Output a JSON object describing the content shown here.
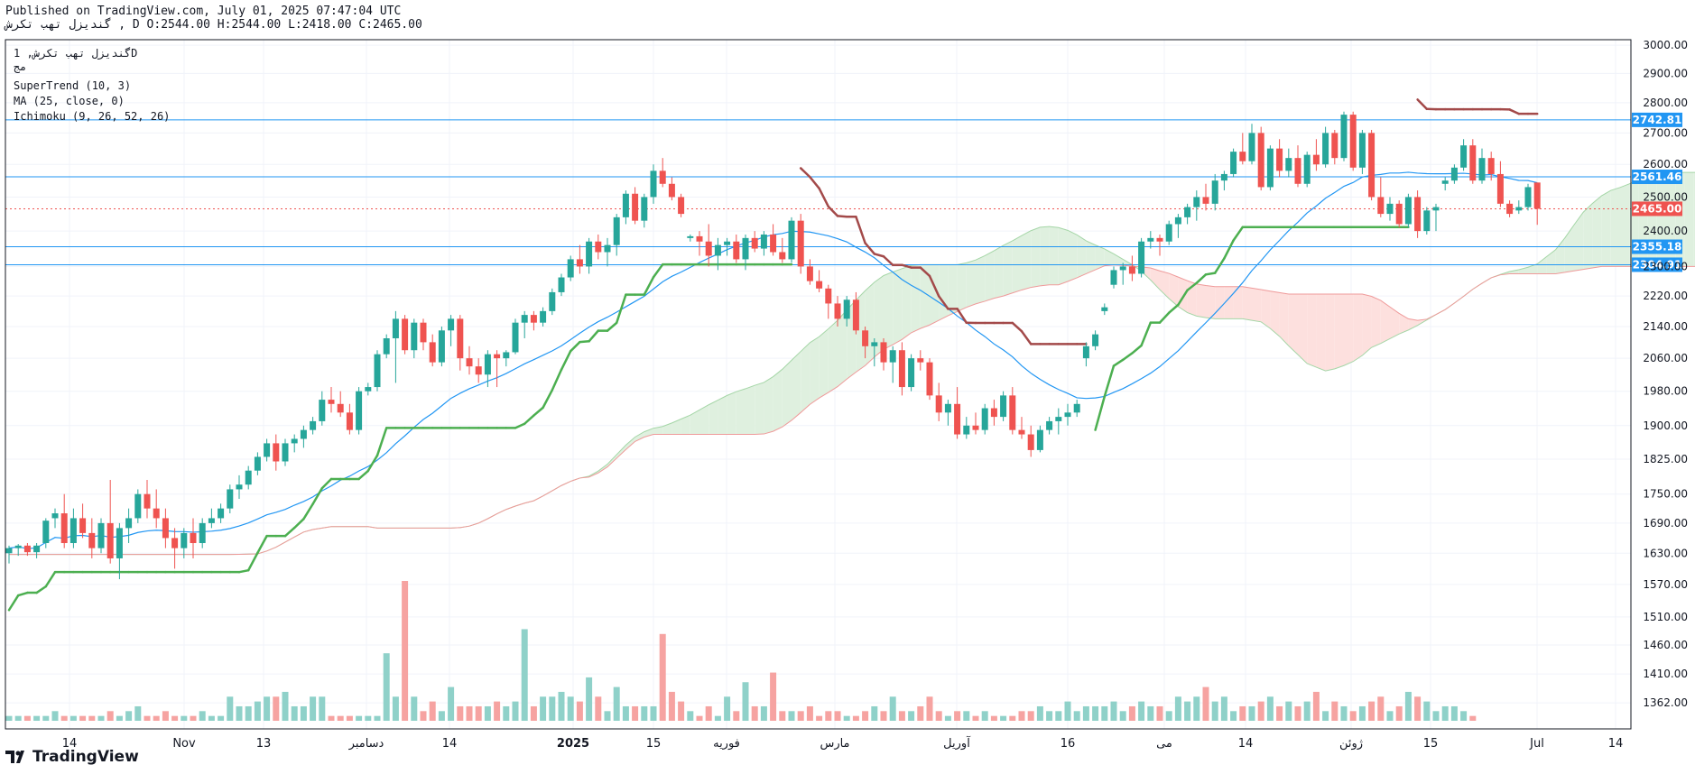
{
  "header": {
    "published_line": "Published on TradingView.com, July 01, 2025 07:47:04 UTC",
    "symbol_line": "گندیزل تهب تکرش , D O:2544.00 H:2544.00 L:2418.00 C:2465.00"
  },
  "legend": {
    "symbol": "گندیزل تهب تکرش, 1D",
    "subtitle": "مج",
    "indicator_1": "SuperTrend (10, 3)",
    "indicator_2": "MA (25, close, 0)",
    "indicator_3": "Ichimoku (9, 26, 52, 26)"
  },
  "footer": {
    "brand": "TradingView"
  },
  "colors": {
    "up": "#26a69a",
    "down": "#ef5350",
    "up_volume": "#8fd1c9",
    "down_volume": "#f6a3a1",
    "supertrend_up": "#4caf50",
    "supertrend_down": "#a34a4a",
    "ma": "#2196f3",
    "hline": "#2196f3",
    "cloud_bull": "#dff0df",
    "cloud_bear": "#fde0de",
    "last_price": "#ef5350"
  },
  "chart_data": {
    "type": "candlestick",
    "timeframe": "1D",
    "ohlc_last": {
      "open": 2544.0,
      "high": 2544.0,
      "low": 2418.0,
      "close": 2465.0
    },
    "y_scale": "log",
    "ylim": [
      1320,
      3020
    ],
    "y_ticks": [
      "3000.00",
      "2900.00",
      "2800.00",
      "2700.00",
      "2600.00",
      "2500.00",
      "2400.00",
      "2300.00",
      "2220.00",
      "2140.00",
      "2060.00",
      "1980.00",
      "1900.00",
      "1825.00",
      "1750.00",
      "1690.00",
      "1630.00",
      "1570.00",
      "1510.00",
      "1460.00",
      "1410.00",
      "1362.00"
    ],
    "x_ticks": [
      "14",
      "Nov",
      "13",
      "دسامبر",
      "14",
      "2025",
      "15",
      "فوریه",
      "مارس",
      "آوریل",
      "16",
      "می",
      "14",
      "ژوئن",
      "15",
      "Jul",
      "14"
    ],
    "horizontal_levels": [
      {
        "price": 2742.81,
        "label": "2742.81"
      },
      {
        "price": 2561.46,
        "label": "2561.46"
      },
      {
        "price": 2355.18,
        "label": "2355.18"
      },
      {
        "price": 2304.91,
        "label": "2304.91"
      }
    ],
    "last_price": {
      "price": 2465.0,
      "label": "2465.00"
    },
    "candles": [
      [
        1630,
        1645,
        1610,
        1640
      ],
      [
        1640,
        1648,
        1625,
        1645
      ],
      [
        1645,
        1650,
        1625,
        1632
      ],
      [
        1632,
        1650,
        1620,
        1645
      ],
      [
        1650,
        1700,
        1640,
        1695
      ],
      [
        1700,
        1720,
        1680,
        1710
      ],
      [
        1710,
        1750,
        1640,
        1650
      ],
      [
        1650,
        1720,
        1640,
        1700
      ],
      [
        1700,
        1730,
        1660,
        1670
      ],
      [
        1670,
        1700,
        1620,
        1640
      ],
      [
        1640,
        1700,
        1630,
        1690
      ],
      [
        1690,
        1780,
        1610,
        1620
      ],
      [
        1620,
        1690,
        1580,
        1680
      ],
      [
        1680,
        1720,
        1650,
        1700
      ],
      [
        1700,
        1760,
        1690,
        1750
      ],
      [
        1750,
        1780,
        1700,
        1720
      ],
      [
        1720,
        1760,
        1680,
        1700
      ],
      [
        1700,
        1720,
        1640,
        1660
      ],
      [
        1660,
        1680,
        1600,
        1640
      ],
      [
        1640,
        1680,
        1620,
        1670
      ],
      [
        1670,
        1700,
        1620,
        1650
      ],
      [
        1650,
        1700,
        1640,
        1690
      ],
      [
        1690,
        1720,
        1680,
        1700
      ],
      [
        1700,
        1730,
        1690,
        1720
      ],
      [
        1720,
        1770,
        1710,
        1760
      ],
      [
        1760,
        1790,
        1740,
        1770
      ],
      [
        1770,
        1810,
        1760,
        1800
      ],
      [
        1800,
        1840,
        1790,
        1830
      ],
      [
        1830,
        1870,
        1820,
        1860
      ],
      [
        1860,
        1880,
        1800,
        1820
      ],
      [
        1820,
        1870,
        1810,
        1860
      ],
      [
        1860,
        1880,
        1840,
        1870
      ],
      [
        1870,
        1900,
        1850,
        1890
      ],
      [
        1890,
        1920,
        1880,
        1910
      ],
      [
        1910,
        1980,
        1900,
        1960
      ],
      [
        1960,
        1990,
        1930,
        1950
      ],
      [
        1950,
        1980,
        1920,
        1930
      ],
      [
        1930,
        1950,
        1880,
        1890
      ],
      [
        1890,
        1990,
        1880,
        1980
      ],
      [
        1980,
        2000,
        1970,
        1990
      ],
      [
        1990,
        2080,
        1980,
        2070
      ],
      [
        2070,
        2120,
        2060,
        2110
      ],
      [
        2110,
        2180,
        2000,
        2160
      ],
      [
        2160,
        2170,
        2070,
        2080
      ],
      [
        2080,
        2160,
        2060,
        2150
      ],
      [
        2150,
        2160,
        2080,
        2100
      ],
      [
        2100,
        2120,
        2040,
        2050
      ],
      [
        2050,
        2140,
        2040,
        2130
      ],
      [
        2130,
        2170,
        2090,
        2160
      ],
      [
        2160,
        2170,
        2030,
        2060
      ],
      [
        2060,
        2090,
        2020,
        2040
      ],
      [
        2040,
        2060,
        2000,
        2020
      ],
      [
        2020,
        2080,
        1990,
        2070
      ],
      [
        2070,
        2080,
        1990,
        2060
      ],
      [
        2060,
        2080,
        2040,
        2075
      ],
      [
        2075,
        2160,
        2070,
        2150
      ],
      [
        2150,
        2180,
        2110,
        2170
      ],
      [
        2170,
        2180,
        2130,
        2150
      ],
      [
        2150,
        2190,
        2140,
        2180
      ],
      [
        2180,
        2240,
        2170,
        2230
      ],
      [
        2230,
        2280,
        2220,
        2270
      ],
      [
        2270,
        2330,
        2260,
        2320
      ],
      [
        2320,
        2360,
        2280,
        2300
      ],
      [
        2300,
        2380,
        2280,
        2370
      ],
      [
        2370,
        2390,
        2320,
        2340
      ],
      [
        2340,
        2380,
        2300,
        2360
      ],
      [
        2360,
        2450,
        2330,
        2440
      ],
      [
        2440,
        2520,
        2420,
        2510
      ],
      [
        2510,
        2530,
        2420,
        2430
      ],
      [
        2430,
        2510,
        2410,
        2500
      ],
      [
        2500,
        2600,
        2480,
        2580
      ],
      [
        2580,
        2620,
        2530,
        2540
      ],
      [
        2540,
        2560,
        2490,
        2500
      ],
      [
        2500,
        2510,
        2440,
        2450
      ],
      [
        2380,
        2390,
        2370,
        2385
      ],
      [
        2385,
        2400,
        2330,
        2370
      ],
      [
        2370,
        2420,
        2300,
        2330
      ],
      [
        2330,
        2380,
        2290,
        2360
      ],
      [
        2360,
        2380,
        2330,
        2370
      ],
      [
        2370,
        2390,
        2310,
        2320
      ],
      [
        2320,
        2390,
        2290,
        2380
      ],
      [
        2380,
        2400,
        2340,
        2350
      ],
      [
        2350,
        2400,
        2330,
        2390
      ],
      [
        2390,
        2420,
        2330,
        2340
      ],
      [
        2340,
        2380,
        2310,
        2320
      ],
      [
        2320,
        2440,
        2310,
        2430
      ],
      [
        2430,
        2450,
        2280,
        2300
      ],
      [
        2300,
        2320,
        2250,
        2260
      ],
      [
        2260,
        2290,
        2230,
        2240
      ],
      [
        2240,
        2250,
        2160,
        2200
      ],
      [
        2200,
        2220,
        2140,
        2160
      ],
      [
        2160,
        2220,
        2140,
        2210
      ],
      [
        2210,
        2230,
        2120,
        2130
      ],
      [
        2130,
        2140,
        2060,
        2090
      ],
      [
        2090,
        2110,
        2040,
        2100
      ],
      [
        2100,
        2110,
        2030,
        2050
      ],
      [
        2050,
        2090,
        2000,
        2080
      ],
      [
        2080,
        2100,
        1970,
        1990
      ],
      [
        1990,
        2070,
        1980,
        2060
      ],
      [
        2060,
        2080,
        2030,
        2050
      ],
      [
        2050,
        2060,
        1960,
        1970
      ],
      [
        1970,
        2000,
        1910,
        1930
      ],
      [
        1930,
        1960,
        1900,
        1950
      ],
      [
        1950,
        1990,
        1870,
        1880
      ],
      [
        1880,
        1920,
        1870,
        1900
      ],
      [
        1900,
        1930,
        1880,
        1890
      ],
      [
        1890,
        1950,
        1880,
        1940
      ],
      [
        1940,
        1960,
        1900,
        1920
      ],
      [
        1920,
        1980,
        1910,
        1970
      ],
      [
        1970,
        1990,
        1880,
        1890
      ],
      [
        1890,
        1920,
        1870,
        1880
      ],
      [
        1880,
        1900,
        1830,
        1845
      ],
      [
        1845,
        1900,
        1840,
        1890
      ],
      [
        1890,
        1920,
        1880,
        1910
      ],
      [
        1910,
        1940,
        1880,
        1920
      ],
      [
        1920,
        1950,
        1900,
        1930
      ],
      [
        1930,
        1960,
        1920,
        1950
      ],
      [
        2060,
        2100,
        2040,
        2090
      ],
      [
        2090,
        2130,
        2080,
        2120
      ],
      [
        2180,
        2200,
        2170,
        2190
      ],
      [
        2250,
        2300,
        2240,
        2290
      ],
      [
        2290,
        2310,
        2250,
        2300
      ],
      [
        2300,
        2330,
        2260,
        2280
      ],
      [
        2280,
        2380,
        2270,
        2370
      ],
      [
        2370,
        2400,
        2350,
        2380
      ],
      [
        2380,
        2390,
        2330,
        2370
      ],
      [
        2370,
        2430,
        2360,
        2420
      ],
      [
        2420,
        2450,
        2380,
        2440
      ],
      [
        2440,
        2480,
        2420,
        2470
      ],
      [
        2470,
        2520,
        2430,
        2500
      ],
      [
        2500,
        2540,
        2460,
        2480
      ],
      [
        2480,
        2570,
        2460,
        2550
      ],
      [
        2550,
        2580,
        2520,
        2570
      ],
      [
        2570,
        2650,
        2560,
        2640
      ],
      [
        2640,
        2700,
        2600,
        2610
      ],
      [
        2610,
        2730,
        2600,
        2700
      ],
      [
        2700,
        2720,
        2520,
        2530
      ],
      [
        2530,
        2660,
        2520,
        2650
      ],
      [
        2650,
        2680,
        2560,
        2580
      ],
      [
        2580,
        2650,
        2560,
        2620
      ],
      [
        2620,
        2660,
        2530,
        2540
      ],
      [
        2540,
        2640,
        2530,
        2630
      ],
      [
        2630,
        2680,
        2580,
        2600
      ],
      [
        2600,
        2720,
        2590,
        2700
      ],
      [
        2700,
        2710,
        2600,
        2620
      ],
      [
        2620,
        2770,
        2610,
        2760
      ],
      [
        2760,
        2770,
        2580,
        2590
      ],
      [
        2590,
        2710,
        2570,
        2700
      ],
      [
        2700,
        2710,
        2490,
        2500
      ],
      [
        2500,
        2560,
        2440,
        2450
      ],
      [
        2450,
        2500,
        2430,
        2480
      ],
      [
        2480,
        2490,
        2410,
        2420
      ],
      [
        2420,
        2510,
        2410,
        2500
      ],
      [
        2500,
        2520,
        2380,
        2400
      ],
      [
        2400,
        2470,
        2390,
        2460
      ],
      [
        2460,
        2480,
        2400,
        2470
      ],
      [
        2540,
        2560,
        2520,
        2550
      ],
      [
        2550,
        2600,
        2540,
        2590
      ],
      [
        2590,
        2680,
        2580,
        2660
      ],
      [
        2660,
        2680,
        2540,
        2550
      ],
      [
        2550,
        2650,
        2540,
        2620
      ],
      [
        2620,
        2640,
        2550,
        2570
      ],
      [
        2570,
        2610,
        2470,
        2480
      ],
      [
        2480,
        2490,
        2440,
        2450
      ],
      [
        2460,
        2490,
        2450,
        2470
      ],
      [
        2470,
        2540,
        2460,
        2530
      ],
      [
        2544,
        2544,
        2418,
        2465
      ]
    ],
    "volume_bars_approx": [
      1,
      1,
      1,
      1,
      1,
      2,
      1,
      1,
      1,
      1,
      1,
      2,
      1,
      2,
      3,
      1,
      1,
      2,
      1,
      1,
      1,
      2,
      1,
      1,
      5,
      3,
      3,
      4,
      5,
      5,
      6,
      3,
      3,
      5,
      5,
      1,
      1,
      1,
      1,
      1,
      1,
      14,
      5,
      29,
      5,
      2,
      4,
      2,
      7,
      3,
      3,
      3,
      3,
      4,
      3,
      4,
      19,
      3,
      5,
      5,
      6,
      5,
      4,
      9,
      5,
      2,
      7,
      3,
      3,
      3,
      3,
      18,
      6,
      4,
      2,
      1,
      3,
      1,
      5,
      2,
      8,
      3,
      3,
      10,
      2,
      2,
      2,
      3,
      1,
      2,
      2,
      1,
      1,
      2,
      3,
      2,
      5,
      2,
      2,
      3,
      5,
      2,
      1,
      2,
      2,
      1,
      2,
      1,
      1,
      1,
      2,
      2,
      3,
      2,
      2,
      4,
      2,
      3,
      3,
      3,
      4,
      2,
      3,
      4,
      3,
      3,
      2,
      5,
      4,
      5,
      7,
      4,
      5,
      2,
      3,
      3,
      4,
      5,
      3,
      4,
      3,
      4,
      6,
      2,
      4,
      3,
      2,
      3,
      4,
      5,
      2,
      3,
      6,
      5,
      4,
      2,
      3,
      3,
      2,
      1
    ]
  }
}
